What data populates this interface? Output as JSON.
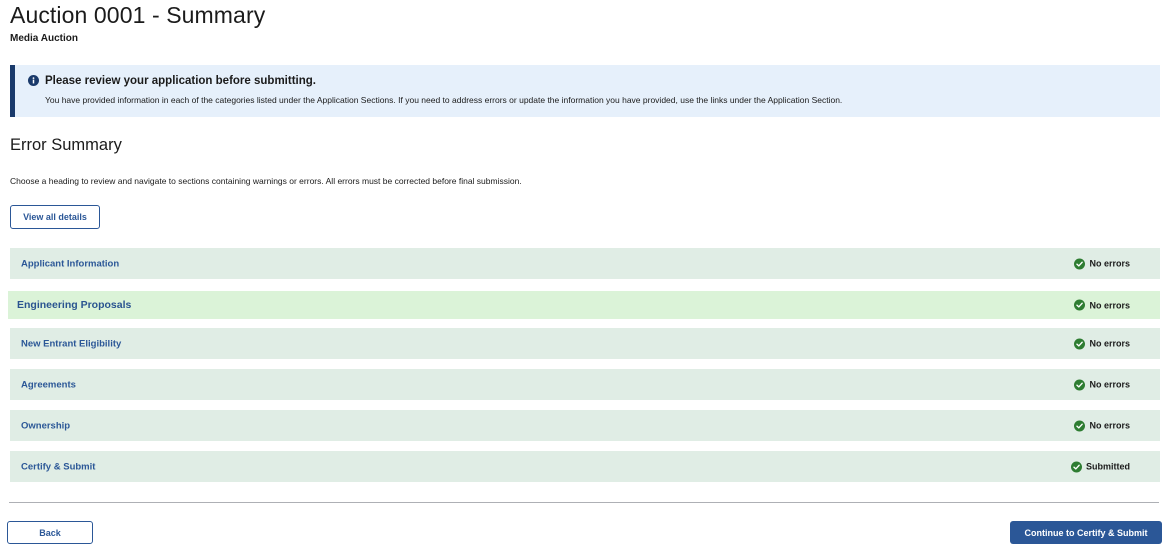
{
  "header": {
    "title": "Auction 0001 - Summary",
    "subtitle": "Media Auction"
  },
  "alert": {
    "icon": "info-icon",
    "heading": "Please review your application before submitting.",
    "body": "You have provided information in each of the categories listed under the Application Sections. If you need to address errors or update the information you have provided, use the links under the Application Section."
  },
  "error_summary": {
    "title": "Error Summary",
    "description": "Choose a heading to review and navigate to sections containing warnings or errors. All errors must be corrected before final submission.",
    "view_all_label": "View all details"
  },
  "sections": [
    {
      "label": "Applicant Information",
      "status": "No errors",
      "status_icon": "check-circle-icon"
    },
    {
      "label": "Engineering Proposals",
      "status": "No errors",
      "status_icon": "check-circle-icon"
    },
    {
      "label": "New Entrant Eligibility",
      "status": "No errors",
      "status_icon": "check-circle-icon"
    },
    {
      "label": "Agreements",
      "status": "No errors",
      "status_icon": "check-circle-icon"
    },
    {
      "label": "Ownership",
      "status": "No errors",
      "status_icon": "check-circle-icon"
    },
    {
      "label": "Certify & Submit",
      "status": "Submitted",
      "status_icon": "check-circle-icon"
    }
  ],
  "footer": {
    "back_label": "Back",
    "continue_label": "Continue to Certify & Submit"
  },
  "colors": {
    "primary": "#2b5797",
    "success": "#2e7d32",
    "alert_bg": "#e6f0fb",
    "row_bg": "#e0ede5",
    "row_highlight_bg": "#dbf3d8"
  }
}
